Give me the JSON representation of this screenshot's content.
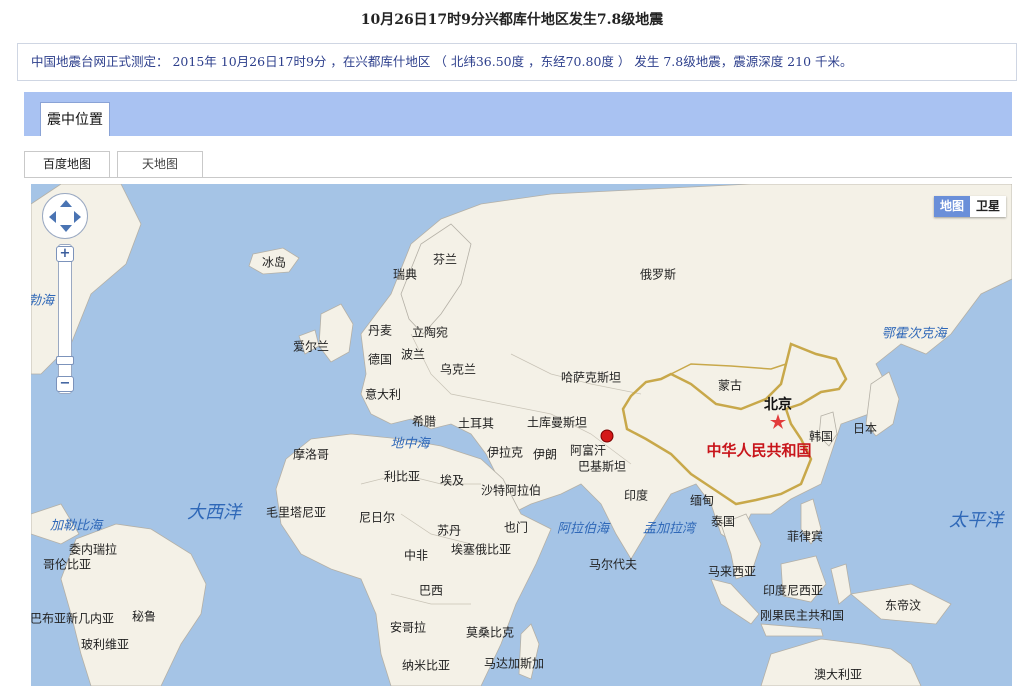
{
  "page": {
    "title": "10月26日17时9分兴都库什地区发生7.8级地震",
    "notice": "中国地震台网正式测定： 2015年 10月26日17时9分 ，在兴都库什地区 （ 北纬36.50度 ，东经70.80度 ） 发生 7.8级地震，震源深度 210 千米。"
  },
  "section": {
    "tab_label": "震中位置"
  },
  "map_tabs": [
    {
      "label": "百度地图",
      "active": true
    },
    {
      "label": "天地图",
      "active": false
    }
  ],
  "map": {
    "type_control": {
      "map_label": "地图",
      "satellite_label": "卫星"
    },
    "zoom": {
      "in_label": "+",
      "out_label": "−"
    },
    "colors": {
      "sea": "#a5c4e6",
      "land": "#f4f1e7",
      "border": "#b4b0a6",
      "china_border": "#c8a84a",
      "epicenter": "#d41818",
      "capital_star": "#e23b3b"
    },
    "labels": [
      {
        "text": "冰岛",
        "kind": "country"
      },
      {
        "text": "芬兰",
        "kind": "country"
      },
      {
        "text": "瑞典",
        "kind": "country"
      },
      {
        "text": "俄罗斯",
        "kind": "country"
      },
      {
        "text": "丹麦",
        "kind": "country"
      },
      {
        "text": "立陶宛",
        "kind": "country"
      },
      {
        "text": "爱尔兰",
        "kind": "country"
      },
      {
        "text": "德国",
        "kind": "country"
      },
      {
        "text": "波兰",
        "kind": "country"
      },
      {
        "text": "乌克兰",
        "kind": "country"
      },
      {
        "text": "哈萨克斯坦",
        "kind": "country"
      },
      {
        "text": "蒙古",
        "kind": "country"
      },
      {
        "text": "意大利",
        "kind": "country"
      },
      {
        "text": "希腊",
        "kind": "country"
      },
      {
        "text": "土耳其",
        "kind": "country"
      },
      {
        "text": "土库曼斯坦",
        "kind": "country"
      },
      {
        "text": "北京",
        "kind": "capital"
      },
      {
        "text": "韩国",
        "kind": "country"
      },
      {
        "text": "日本",
        "kind": "country"
      },
      {
        "text": "地中海",
        "kind": "ocean"
      },
      {
        "text": "阿富汗",
        "kind": "country"
      },
      {
        "text": "中华人民共和国",
        "kind": "main"
      },
      {
        "text": "摩洛哥",
        "kind": "country"
      },
      {
        "text": "伊拉克",
        "kind": "country"
      },
      {
        "text": "伊朗",
        "kind": "country"
      },
      {
        "text": "巴基斯坦",
        "kind": "country"
      },
      {
        "text": "利比亚",
        "kind": "country"
      },
      {
        "text": "埃及",
        "kind": "country"
      },
      {
        "text": "沙特阿拉伯",
        "kind": "country"
      },
      {
        "text": "印度",
        "kind": "country"
      },
      {
        "text": "缅甸",
        "kind": "country"
      },
      {
        "text": "大西洋",
        "kind": "ocean-big"
      },
      {
        "text": "毛里塔尼亚",
        "kind": "country"
      },
      {
        "text": "尼日尔",
        "kind": "country"
      },
      {
        "text": "苏丹",
        "kind": "country"
      },
      {
        "text": "也门",
        "kind": "country"
      },
      {
        "text": "阿拉伯海",
        "kind": "ocean"
      },
      {
        "text": "孟加拉湾",
        "kind": "ocean"
      },
      {
        "text": "泰国",
        "kind": "country"
      },
      {
        "text": "菲律宾",
        "kind": "country"
      },
      {
        "text": "太平洋",
        "kind": "ocean-big"
      },
      {
        "text": "加勒比海",
        "kind": "ocean"
      },
      {
        "text": "委内瑞拉",
        "kind": "country"
      },
      {
        "text": "哥伦比亚",
        "kind": "country"
      },
      {
        "text": "中非",
        "kind": "country"
      },
      {
        "text": "埃塞俄比亚",
        "kind": "country"
      },
      {
        "text": "马尔代夫",
        "kind": "country"
      },
      {
        "text": "马来西亚",
        "kind": "country"
      },
      {
        "text": "印度尼西亚",
        "kind": "country"
      },
      {
        "text": "刚果民主共和国",
        "kind": "country"
      },
      {
        "text": "东帝汶",
        "kind": "country"
      },
      {
        "text": "巴布亚新几内亚",
        "kind": "country"
      },
      {
        "text": "秘鲁",
        "kind": "country"
      },
      {
        "text": "巴西",
        "kind": "country"
      },
      {
        "text": "安哥拉",
        "kind": "country"
      },
      {
        "text": "莫桑比克",
        "kind": "country"
      },
      {
        "text": "玻利维亚",
        "kind": "country"
      },
      {
        "text": "纳米比亚",
        "kind": "country"
      },
      {
        "text": "马达加斯加",
        "kind": "country"
      },
      {
        "text": "澳大利亚",
        "kind": "country"
      },
      {
        "text": "鄂霍次克海",
        "kind": "ocean"
      },
      {
        "text": "勃海",
        "kind": "ocean"
      }
    ]
  }
}
